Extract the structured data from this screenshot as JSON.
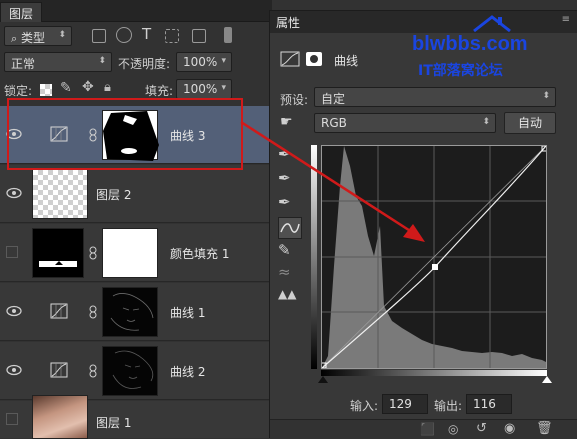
{
  "layers_panel": {
    "tab_label": "图层",
    "filter_kind": "类型",
    "blend_mode": "正常",
    "opacity_label": "不透明度:",
    "opacity_value": "100%",
    "lock_label": "锁定:",
    "fill_label": "填充:",
    "fill_value": "100%",
    "layers": [
      {
        "name": "曲线 3",
        "visible": true,
        "selected": true
      },
      {
        "name": "图层 2",
        "visible": true,
        "selected": false
      },
      {
        "name": "颜色填充 1",
        "visible": false,
        "selected": false
      },
      {
        "name": "曲线 1",
        "visible": true,
        "selected": false
      },
      {
        "name": "曲线 2",
        "visible": true,
        "selected": false
      },
      {
        "name": "图层 1",
        "visible": false,
        "selected": false
      }
    ]
  },
  "properties_panel": {
    "tab_label": "属性",
    "title": "曲线",
    "preset_label": "预设:",
    "preset_value": "自定",
    "channel_value": "RGB",
    "auto_button": "自动",
    "input_label": "输入:",
    "input_value": "129",
    "output_label": "输出:",
    "output_value": "116",
    "curve_point": {
      "input": 129,
      "output": 116
    }
  },
  "watermark": {
    "line1": "blwbbs.com",
    "line2": "IT部落窝论坛"
  },
  "colors": {
    "selected_row": "#536078",
    "highlight_red": "#d01a1a",
    "logo_blue": "#1a45e0"
  }
}
